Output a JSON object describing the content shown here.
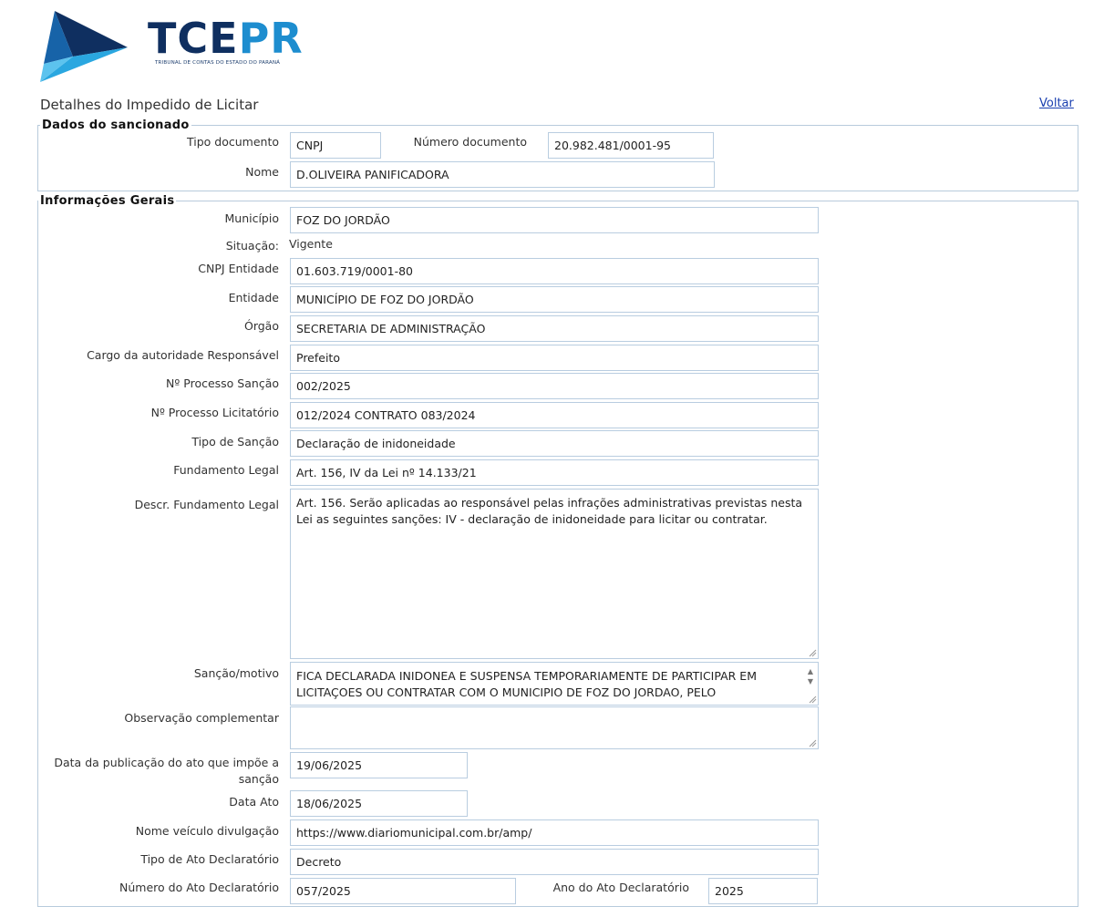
{
  "brand": {
    "name_part1": "TCE",
    "name_part2": "PR",
    "subtitle": "TRIBUNAL DE CONTAS DO ESTADO DO PARANÁ",
    "colors": {
      "dark": "#0f2f60",
      "light": "#1d8dcf"
    }
  },
  "header": {
    "title": "Detalhes do Impedido de Licitar",
    "back_label": "Voltar"
  },
  "dados_sancionado": {
    "legend": "Dados do sancionado",
    "tipo_documento_label": "Tipo documento",
    "tipo_documento": "CNPJ",
    "numero_documento_label": "Número documento",
    "numero_documento": "20.982.481/0001-95",
    "nome_label": "Nome",
    "nome": "D.OLIVEIRA PANIFICADORA"
  },
  "info": {
    "legend": "Informações Gerais",
    "municipio_label": "Município",
    "municipio": "FOZ DO JORDÃO",
    "situacao_label": "Situação:",
    "situacao": "Vigente",
    "cnpj_entidade_label": "CNPJ Entidade",
    "cnpj_entidade": "01.603.719/0001-80",
    "entidade_label": "Entidade",
    "entidade": "MUNICÍPIO DE FOZ DO JORDÃO",
    "orgao_label": "Órgão",
    "orgao": "SECRETARIA DE ADMINISTRAÇÃO",
    "cargo_label": "Cargo da autoridade Responsável",
    "cargo": "Prefeito",
    "processo_sancao_label": "Nº Processo Sanção",
    "processo_sancao": "002/2025",
    "processo_licitatorio_label": "Nº Processo Licitatório",
    "processo_licitatorio": "012/2024 CONTRATO 083/2024",
    "tipo_sancao_label": "Tipo de Sanção",
    "tipo_sancao": "Declaração de inidoneidade",
    "fundamento_label": "Fundamento Legal",
    "fundamento": "Art. 156, IV da Lei nº 14.133/21",
    "descr_fundamento_label": "Descr. Fundamento Legal",
    "descr_fundamento": "Art. 156. Serão aplicadas ao responsável pelas infrações administrativas previstas nesta Lei as seguintes sanções: IV - declaração de inidoneidade para licitar ou contratar.",
    "sancao_motivo_label": "Sanção/motivo",
    "sancao_motivo": "FICA DECLARADA INIDONEA E SUSPENSA TEMPORARIAMENTE DE PARTICIPAR EM LICITAÇOES OU CONTRATAR COM O MUNICIPIO DE FOZ DO JORDAO, PELO",
    "observacao_label": "Observação complementar",
    "observacao": "",
    "data_publicacao_label": "Data da publicação do ato que impõe a sanção",
    "data_publicacao": "19/06/2025",
    "data_ato_label": "Data Ato",
    "data_ato": "18/06/2025",
    "veiculo_label": "Nome veículo divulgação",
    "veiculo": "https://www.diariomunicipal.com.br/amp/",
    "tipo_ato_label": "Tipo de Ato Declaratório",
    "tipo_ato": "Decreto",
    "numero_ato_label": "Número do Ato Declaratório",
    "numero_ato": "057/2025",
    "ano_ato_label": "Ano do Ato Declaratório",
    "ano_ato": "2025"
  }
}
